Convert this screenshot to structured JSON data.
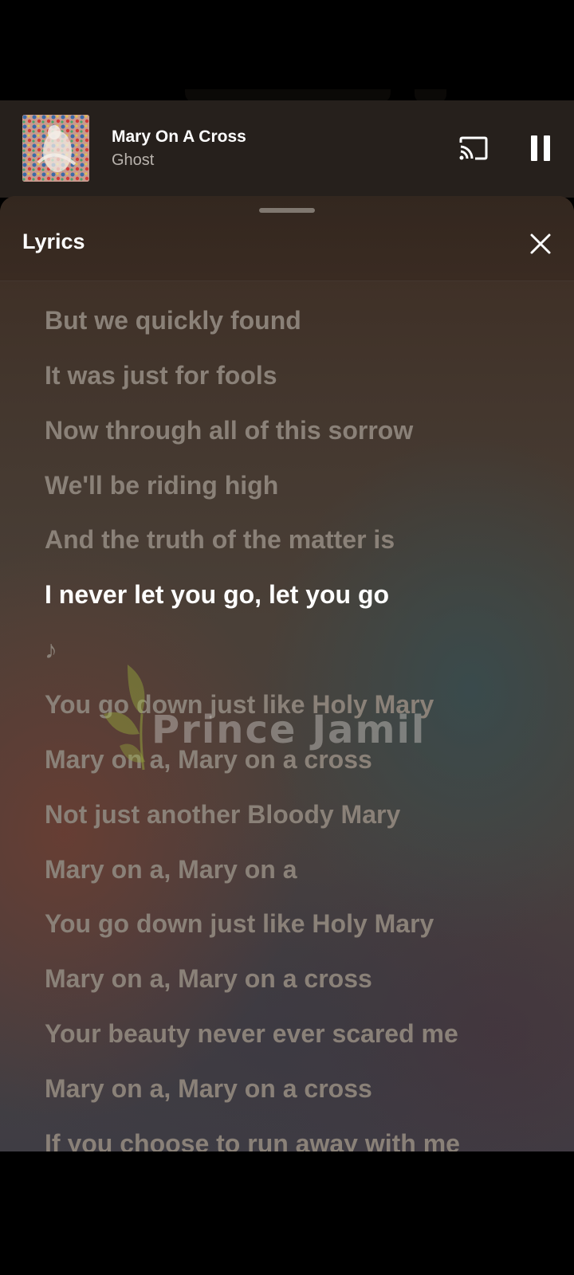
{
  "now_playing": {
    "title": "Mary On A Cross",
    "artist": "Ghost",
    "album_art_icon": "album-art-image"
  },
  "controls": {
    "cast_icon": "cast-icon",
    "pause_icon": "pause-icon"
  },
  "lyrics_sheet": {
    "title": "Lyrics",
    "close_icon": "close-icon",
    "accent_color": "#ffffff",
    "inactive_color": "#8a8178"
  },
  "lyrics": {
    "lines": [
      "But we quickly found",
      "It was just for fools",
      "Now through all of this sorrow",
      "We'll be riding high",
      "And the truth of the matter is",
      "I never let you go, let you go",
      "♪",
      "You go down just like Holy Mary",
      "Mary on a, Mary on a cross",
      "Not just another Bloody Mary",
      "Mary on a, Mary on a",
      "You go down just like Holy Mary",
      "Mary on a, Mary on a cross",
      "Your beauty never ever scared me",
      "Mary on a, Mary on a cross",
      "If you choose to run away with me"
    ],
    "active_index": 5
  },
  "watermark": {
    "text": "Prince Jamil"
  }
}
